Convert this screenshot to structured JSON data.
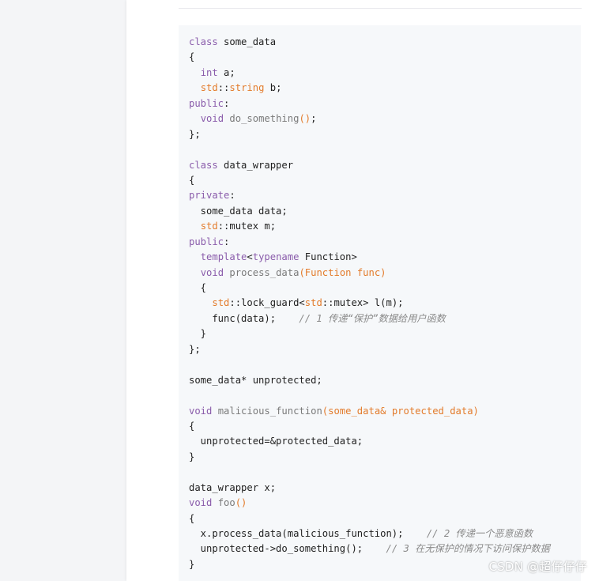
{
  "code": {
    "lines": [
      [
        {
          "t": "class",
          "c": "kw"
        },
        {
          "t": " some_data",
          "c": "txt"
        }
      ],
      [
        {
          "t": "{",
          "c": "txt"
        }
      ],
      [
        {
          "t": "  ",
          "c": "txt"
        },
        {
          "t": "int",
          "c": "ty"
        },
        {
          "t": " a;",
          "c": "txt"
        }
      ],
      [
        {
          "t": "  ",
          "c": "txt"
        },
        {
          "t": "std",
          "c": "ns"
        },
        {
          "t": "::",
          "c": "txt"
        },
        {
          "t": "string",
          "c": "ns"
        },
        {
          "t": " b;",
          "c": "txt"
        }
      ],
      [
        {
          "t": "public",
          "c": "kw"
        },
        {
          "t": ":",
          "c": "txt"
        }
      ],
      [
        {
          "t": "  ",
          "c": "txt"
        },
        {
          "t": "void",
          "c": "ty"
        },
        {
          "t": " ",
          "c": "txt"
        },
        {
          "t": "do_something",
          "c": "fn"
        },
        {
          "t": "()",
          "c": "par"
        },
        {
          "t": ";",
          "c": "txt"
        }
      ],
      [
        {
          "t": "};",
          "c": "txt"
        }
      ],
      [],
      [
        {
          "t": "class",
          "c": "kw"
        },
        {
          "t": " data_wrapper",
          "c": "txt"
        }
      ],
      [
        {
          "t": "{",
          "c": "txt"
        }
      ],
      [
        {
          "t": "private",
          "c": "kw"
        },
        {
          "t": ":",
          "c": "txt"
        }
      ],
      [
        {
          "t": "  some_data data;",
          "c": "txt"
        }
      ],
      [
        {
          "t": "  ",
          "c": "txt"
        },
        {
          "t": "std",
          "c": "ns"
        },
        {
          "t": "::mutex m;",
          "c": "txt"
        }
      ],
      [
        {
          "t": "public",
          "c": "kw"
        },
        {
          "t": ":",
          "c": "txt"
        }
      ],
      [
        {
          "t": "  ",
          "c": "txt"
        },
        {
          "t": "template",
          "c": "kw"
        },
        {
          "t": "<",
          "c": "txt"
        },
        {
          "t": "typename",
          "c": "kw"
        },
        {
          "t": " Function>",
          "c": "txt"
        }
      ],
      [
        {
          "t": "  ",
          "c": "txt"
        },
        {
          "t": "void",
          "c": "ty"
        },
        {
          "t": " ",
          "c": "txt"
        },
        {
          "t": "process_data",
          "c": "fn"
        },
        {
          "t": "(Function func)",
          "c": "par"
        }
      ],
      [
        {
          "t": "  {",
          "c": "txt"
        }
      ],
      [
        {
          "t": "    ",
          "c": "txt"
        },
        {
          "t": "std",
          "c": "ns"
        },
        {
          "t": "::lock_guard<",
          "c": "txt"
        },
        {
          "t": "std",
          "c": "ns"
        },
        {
          "t": "::mutex> l(m);",
          "c": "txt"
        }
      ],
      [
        {
          "t": "    func(data);    ",
          "c": "txt"
        },
        {
          "t": "// 1 传递“保护”数据给用户函数",
          "c": "cm"
        }
      ],
      [
        {
          "t": "  }",
          "c": "txt"
        }
      ],
      [
        {
          "t": "};",
          "c": "txt"
        }
      ],
      [],
      [
        {
          "t": "some_data* unprotected;",
          "c": "txt"
        }
      ],
      [],
      [
        {
          "t": "void",
          "c": "ty"
        },
        {
          "t": " ",
          "c": "txt"
        },
        {
          "t": "malicious_function",
          "c": "fn"
        },
        {
          "t": "(some_data& protected_data)",
          "c": "par"
        }
      ],
      [
        {
          "t": "{",
          "c": "txt"
        }
      ],
      [
        {
          "t": "  unprotected=&protected_data;",
          "c": "txt"
        }
      ],
      [
        {
          "t": "}",
          "c": "txt"
        }
      ],
      [],
      [
        {
          "t": "data_wrapper x;",
          "c": "txt"
        }
      ],
      [
        {
          "t": "void",
          "c": "ty"
        },
        {
          "t": " ",
          "c": "txt"
        },
        {
          "t": "foo",
          "c": "fn"
        },
        {
          "t": "()",
          "c": "par"
        }
      ],
      [
        {
          "t": "{",
          "c": "txt"
        }
      ],
      [
        {
          "t": "  x.process_data(malicious_function);    ",
          "c": "txt"
        },
        {
          "t": "// 2 传递一个恶意函数",
          "c": "cm"
        }
      ],
      [
        {
          "t": "  unprotected->do_something();    ",
          "c": "txt"
        },
        {
          "t": "// 3 在无保护的情况下访问保护数据",
          "c": "cm"
        }
      ],
      [
        {
          "t": "}",
          "c": "txt"
        }
      ]
    ]
  },
  "watermark": {
    "text": "CSDN @超仔仔仔"
  }
}
